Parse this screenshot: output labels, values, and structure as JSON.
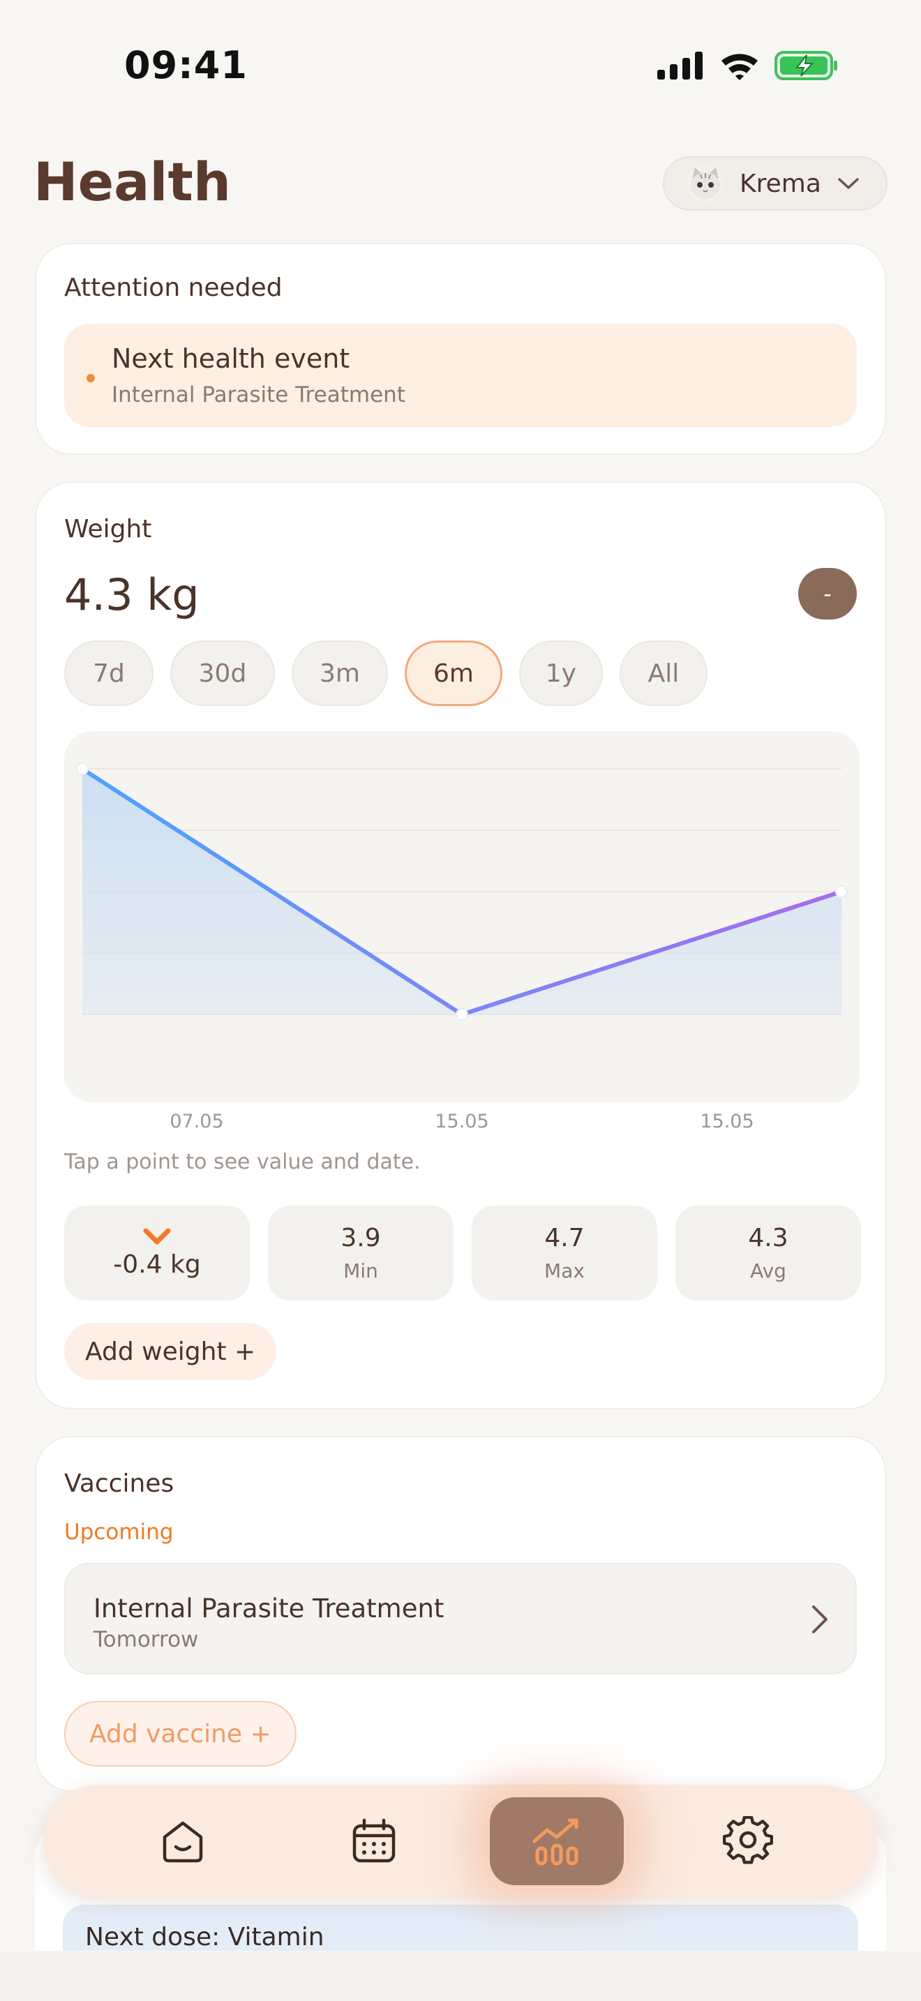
{
  "status_bar": {
    "time": "09:41"
  },
  "header": {
    "title": "Health",
    "pet_name": "Krema"
  },
  "attention": {
    "title": "Attention needed",
    "event_title": "Next health event",
    "event_subtitle": "Internal Parasite Treatment"
  },
  "weight": {
    "title": "Weight",
    "value": "4.3 kg",
    "minus_label": "-",
    "ranges": [
      "7d",
      "30d",
      "3m",
      "6m",
      "1y",
      "All"
    ],
    "active_range": "6m",
    "x_labels": [
      "07.05",
      "15.05",
      "15.05"
    ],
    "hint": "Tap a point to see value and date.",
    "change": "-0.4 kg",
    "stats": [
      {
        "value": "3.9",
        "label": "Min"
      },
      {
        "value": "4.7",
        "label": "Max"
      },
      {
        "value": "4.3",
        "label": "Avg"
      }
    ],
    "add_label": "Add weight +"
  },
  "chart_data": {
    "type": "line",
    "x": [
      "07.05",
      "15.05",
      "15.05"
    ],
    "values": [
      4.7,
      3.9,
      4.3
    ],
    "ylim": [
      3.9,
      4.7
    ],
    "grid": true,
    "title": "",
    "xlabel": "",
    "ylabel": ""
  },
  "vaccines": {
    "title": "Vaccines",
    "upcoming_label": "Upcoming",
    "item_name": "Internal Parasite Treatment",
    "item_when": "Tomorrow",
    "add_label": "Add vaccine +"
  },
  "dose": {
    "text": "Next dose: Vitamin"
  },
  "tabbar": {
    "items": [
      {
        "icon": "home-icon"
      },
      {
        "icon": "calendar-icon"
      },
      {
        "icon": "chart-icon"
      },
      {
        "icon": "gear-icon"
      }
    ],
    "active_index": 2
  },
  "colors": {
    "accent": "#ef7a22",
    "line_start": "#4da3ff",
    "line_end": "#a66cf0",
    "pill_active_border": "#f3a97a"
  }
}
